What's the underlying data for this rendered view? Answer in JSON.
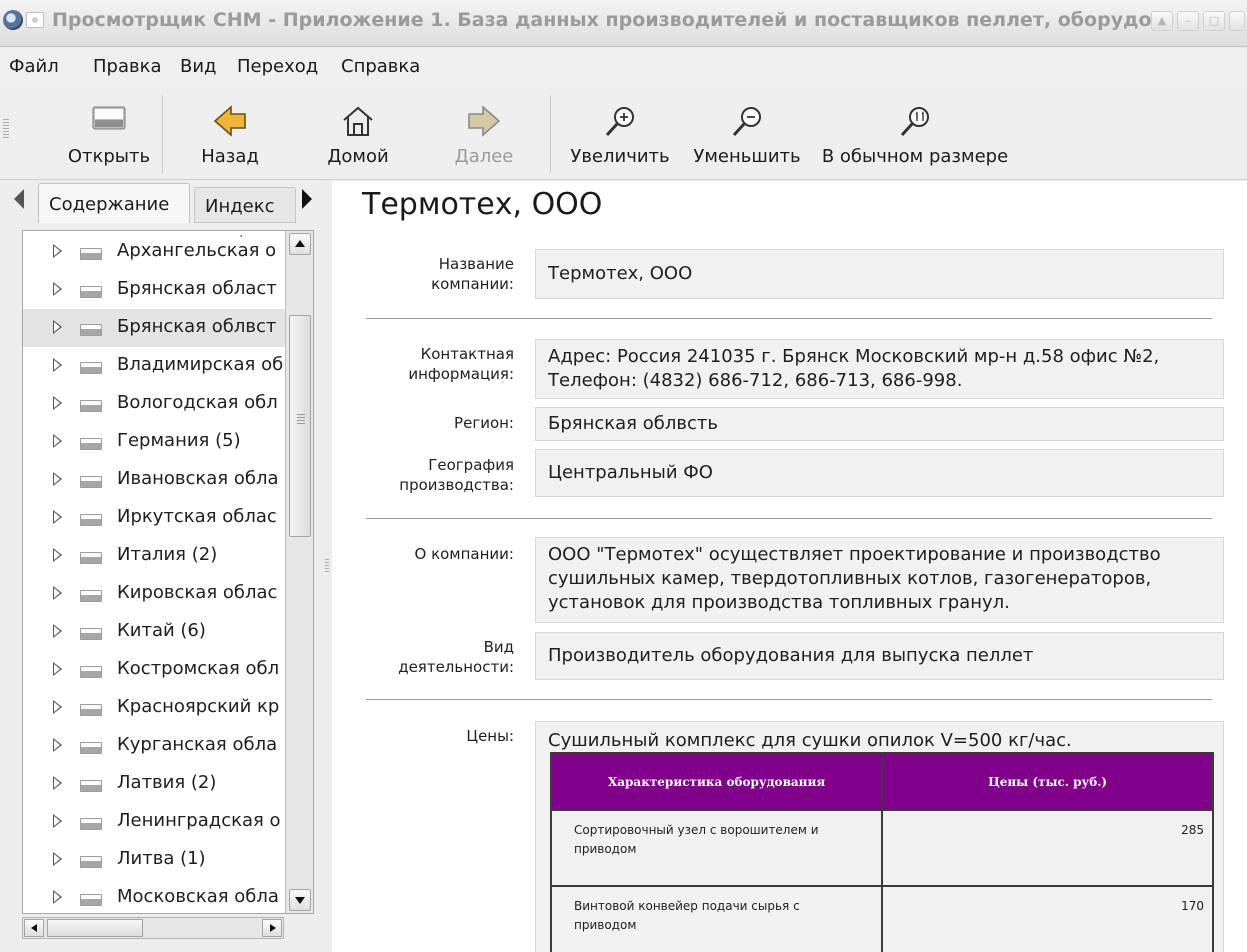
{
  "window": {
    "title": "Просмотрщик CHM - Приложение 1. База данных производителей и поставщиков пеллет, оборудо"
  },
  "menubar": {
    "items": [
      "Файл",
      "Правка",
      "Вид",
      "Переход",
      "Справка"
    ]
  },
  "toolbar": {
    "open": "Открыть",
    "back": "Назад",
    "home": "Домой",
    "forward": "Далее",
    "zoom_in": "Увеличить",
    "zoom_out": "Уменьшить",
    "zoom_reset": "В обычном размере"
  },
  "sidebar": {
    "tabs": [
      "Содержание",
      "Индекс"
    ],
    "items": [
      "Архангельская о",
      "Брянская област",
      "Брянская облвст",
      "Владимирская об",
      "Вологодская обл",
      "Германия (5)",
      "Ивановская обла",
      "Иркутская облас",
      "Италия (2)",
      "Кировская облас",
      "Китай (6)",
      "Костромская обл",
      "Красноярский кр",
      "Курганская обла",
      "Латвия (2)",
      "Ленинградская о",
      "Литва (1)",
      "Московская обла"
    ],
    "selected_index": 2
  },
  "content": {
    "title": "Термотех, ООО",
    "company_label": "Название компании:",
    "company_value": "Термотех, ООО",
    "contact_label": "Контактная информация:",
    "contact_value": "Адрес: Россия 241035 г. Брянск Московский мр-н д.58 офис №2, Телефон: (4832) 686-712, 686-713, 686-998.",
    "region_label": "Регион:",
    "region_value": "Брянская облвсть",
    "geo_label": "География производства:",
    "geo_value": "Центральный ФО",
    "about_label": "О компании:",
    "about_value": "ООО \"Термотех\" осуществляет проектирование и производство сушильных камер, твердотопливных котлов, газогенераторов, установок для производства топливных гранул.",
    "activity_label": "Вид деятельности:",
    "activity_value": "Производитель оборудования для выпуска пеллет",
    "prices_label": "Цены:",
    "prices_caption": "Сушильный комплекс для сушки опилок V=500 кг/час.",
    "table": {
      "headers": [
        "Характеристика оборудования",
        "Цены (тыс. руб.)"
      ],
      "rows": [
        {
          "item": "Сортировочный узел с ворошителем и приводом",
          "price": "285"
        },
        {
          "item": "Винтовой конвейер подачи сырья с приводом",
          "price": "170"
        }
      ]
    }
  },
  "colors": {
    "table_header_bg": "#80008a",
    "toolbar_arrow": "#f0b43c"
  }
}
